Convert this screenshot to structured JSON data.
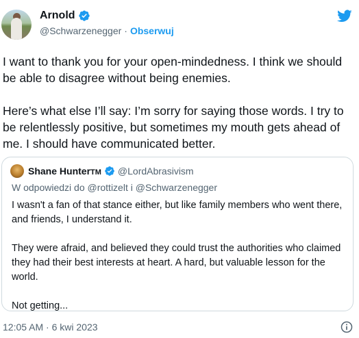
{
  "author": {
    "name": "Arnold",
    "handle": "@Schwarzenegger",
    "separator": "·",
    "follow_label": "Obserwuj"
  },
  "tweet": {
    "paragraphs": [
      "I want to thank you for your open-mindedness. I think we should be able to disagree without being enemies.",
      "Here’s what else I’ll say: I’m sorry for saying those words. I try to be relentlessly positive, but sometimes my mouth gets ahead of me. I should have communicated better."
    ]
  },
  "quote": {
    "name": "Shane Hunter",
    "name_suffix": "TM",
    "handle": "@LordAbrasivism",
    "reply_context": "W odpowiedzi do @rottizelt i @Schwarzenegger",
    "paragraphs": [
      "I wasn't a fan of that stance either, but like family members who went there, and friends, I understand it.",
      "They were afraid, and believed they could trust the authorities who claimed they had their best interests at heart. A hard, but valuable lesson for the world.",
      "Not getting..."
    ]
  },
  "footer": {
    "timestamp": "12:05 AM · 6 kwi 2023"
  },
  "colors": {
    "accent": "#1d9bf0",
    "text": "#0f1419",
    "muted": "#536471",
    "border": "#cfd9de"
  },
  "icons": {
    "verified": "verified-badge-icon",
    "brand": "twitter-bird-icon",
    "info": "info-icon"
  }
}
